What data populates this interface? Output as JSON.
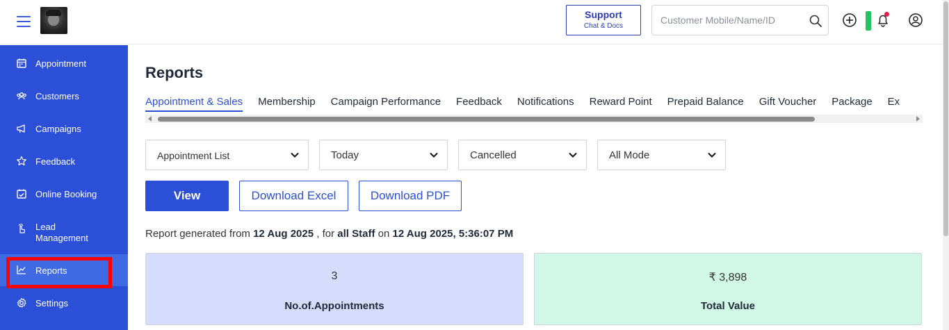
{
  "topbar": {
    "support_title": "Support",
    "support_sub": "Chat & Docs",
    "search_placeholder": "Customer Mobile/Name/ID"
  },
  "sidebar": {
    "items": [
      {
        "label": "Appointment",
        "icon": "calendar-icon"
      },
      {
        "label": "Customers",
        "icon": "users-icon"
      },
      {
        "label": "Campaigns",
        "icon": "megaphone-icon"
      },
      {
        "label": "Feedback",
        "icon": "star-icon"
      },
      {
        "label": "Online Booking",
        "icon": "calendar-check-icon"
      },
      {
        "label": "Lead",
        "label2": "Management",
        "icon": "hand-pointer-icon"
      },
      {
        "label": "Reports",
        "icon": "chart-line-icon"
      },
      {
        "label": "Settings",
        "icon": "gear-icon"
      }
    ]
  },
  "main": {
    "title": "Reports",
    "tabs": [
      "Appointment & Sales",
      "Membership",
      "Campaign Performance",
      "Feedback",
      "Notifications",
      "Reward Point",
      "Prepaid Balance",
      "Gift Voucher",
      "Package",
      "Ex"
    ],
    "filters": {
      "report_type": "Appointment List",
      "date_range": "Today",
      "status": "Cancelled",
      "mode": "All Mode"
    },
    "buttons": {
      "view": "View",
      "download_excel": "Download Excel",
      "download_pdf": "Download PDF"
    },
    "report_info": {
      "prefix": "Report generated from",
      "from_date": "12 Aug 2025",
      "mid": ", for",
      "staff": "all Staff",
      "on": "on",
      "generated_at": "12 Aug 2025, 5:36:07 PM"
    },
    "cards": [
      {
        "value": "3",
        "caption": "No.of.Appointments",
        "bg": "#d6dcfb"
      },
      {
        "value": "₹ 3,898",
        "caption": "Total Value",
        "bg": "#d1f7e6"
      }
    ]
  },
  "colors": {
    "sidebar": "#2b4fd6",
    "accent": "#2b4fd6",
    "highlight": "#ff0000"
  }
}
